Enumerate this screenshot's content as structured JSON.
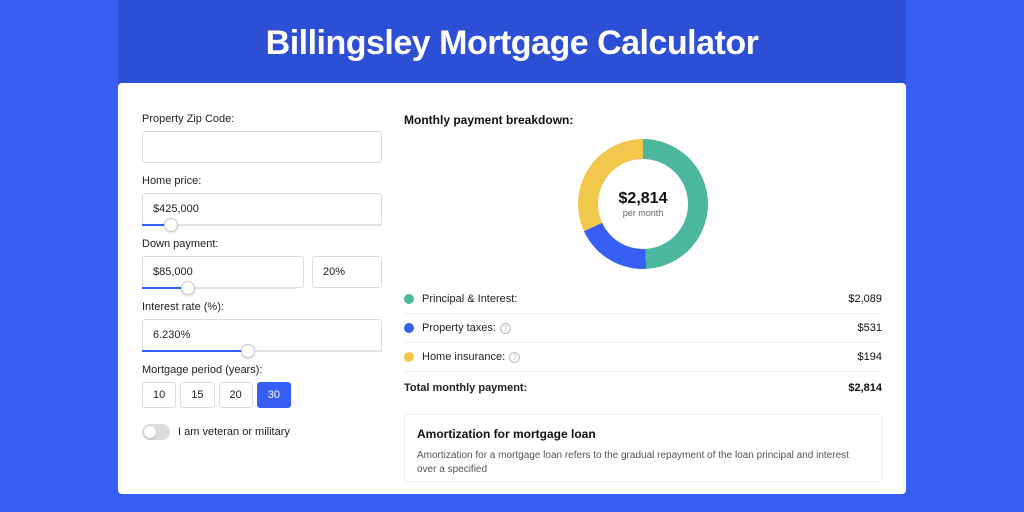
{
  "page_title": "Billingsley Mortgage Calculator",
  "colors": {
    "principal": "#4bb89d",
    "taxes": "#375ff5",
    "insurance": "#f1c84c"
  },
  "form": {
    "zip_label": "Property Zip Code:",
    "zip_value": "",
    "home_price_label": "Home price:",
    "home_price_value": "$425,000",
    "home_price_slider_pct": 12,
    "down_payment_label": "Down payment:",
    "down_payment_value": "$85,000",
    "down_payment_pct": "20%",
    "down_payment_slider_pct": 30,
    "interest_label": "Interest rate (%):",
    "interest_value": "6.230%",
    "interest_slider_pct": 44,
    "period_label": "Mortgage period (years):",
    "periods": [
      "10",
      "15",
      "20",
      "30"
    ],
    "period_selected": "30",
    "veteran_label": "I am veteran or military"
  },
  "breakdown": {
    "title": "Monthly payment breakdown:",
    "donut_amount": "$2,814",
    "donut_sub": "per month",
    "items": [
      {
        "label": "Principal & Interest:",
        "value": "$2,089",
        "color_key": "principal",
        "info": false
      },
      {
        "label": "Property taxes:",
        "value": "$531",
        "color_key": "taxes",
        "info": true
      },
      {
        "label": "Home insurance:",
        "value": "$194",
        "color_key": "insurance",
        "info": true
      }
    ],
    "total_label": "Total monthly payment:",
    "total_value": "$2,814"
  },
  "amortization": {
    "title": "Amortization for mortgage loan",
    "text": "Amortization for a mortgage loan refers to the gradual repayment of the loan principal and interest over a specified"
  },
  "chart_data": {
    "type": "pie",
    "title": "Monthly payment breakdown",
    "series": [
      {
        "name": "Principal & Interest",
        "value": 2089,
        "color": "#4bb89d"
      },
      {
        "name": "Property taxes",
        "value": 531,
        "color": "#375ff5"
      },
      {
        "name": "Home insurance",
        "value": 194,
        "color": "#f1c84c"
      }
    ],
    "total": 2814,
    "center_label": "$2,814 per month"
  }
}
